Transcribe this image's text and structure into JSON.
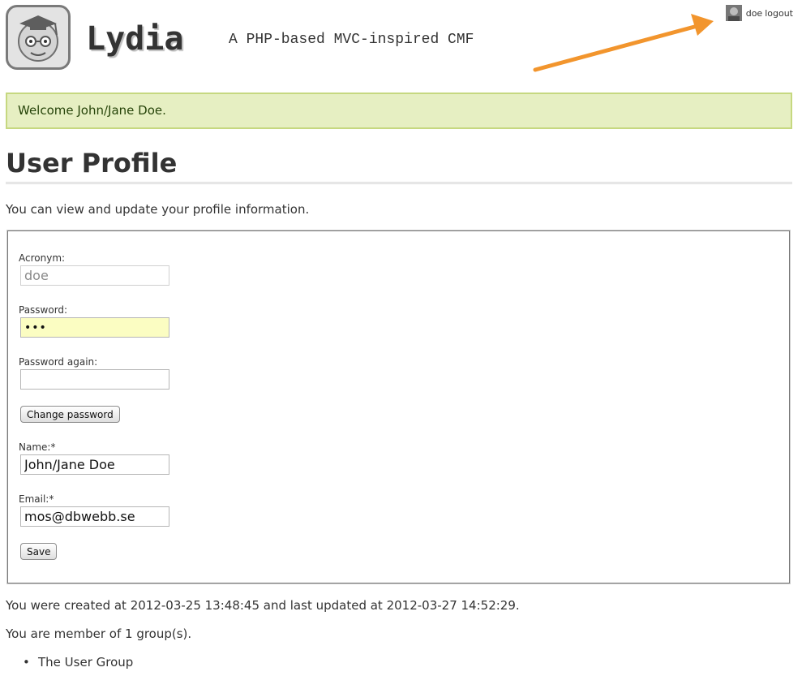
{
  "header": {
    "site_title": "Lydia",
    "site_slogan": "A PHP-based MVC-inspired CMF",
    "logo_icon": "lydia-logo-icon",
    "login_menu": {
      "username": "doe",
      "logout_label": "logout",
      "avatar_icon": "user-avatar-icon"
    },
    "annotation_color": "#f2952d"
  },
  "welcome_message": "Welcome John/Jane Doe.",
  "page": {
    "title": "User Profile",
    "intro": "You can view and update your profile information."
  },
  "form": {
    "acronym": {
      "label": "Acronym:",
      "value": "doe"
    },
    "password": {
      "label": "Password:",
      "value": "•••"
    },
    "password_again": {
      "label": "Password again:",
      "value": ""
    },
    "change_password_button": "Change password",
    "name": {
      "label": "Name:*",
      "value": "John/Jane Doe"
    },
    "email": {
      "label": "Email:*",
      "value": "mos@dbwebb.se"
    },
    "save_button": "Save"
  },
  "meta": {
    "created_text": "You were created at 2012-03-25 13:48:45 and last updated at 2012-03-27 14:52:29.",
    "groups_text": "You are member of 1 group(s).",
    "groups": [
      "The User Group"
    ]
  },
  "colors": {
    "welcome_bg": "#e6efc2",
    "welcome_border": "#c6d880",
    "welcome_text": "#264409",
    "password_fill": "#fbfdc2"
  }
}
